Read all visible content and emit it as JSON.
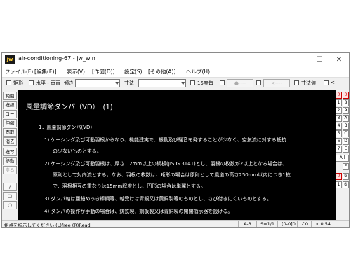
{
  "window": {
    "title": "air-conditioning-67 - jw_win",
    "icon_text": "jw",
    "controls": {
      "minimize": "─",
      "maximize": "☐",
      "close": "✕"
    }
  },
  "menu": [
    "ファイル(F)",
    "[編集(E)]",
    "表示(V)",
    "[作図(D)]",
    "設定(S)",
    "[その他(A)]",
    "ヘルプ(H)"
  ],
  "toolbar": {
    "rect_label": "矩形",
    "hv_label": "水平・垂直",
    "slope_label": "傾き",
    "dim_label": "寸法",
    "deg15_label": "15度毎",
    "btn_a": "●----",
    "btn_b": "<----",
    "dimval_label": "寸法値",
    "lt_label": "<"
  },
  "left_tools": [
    "範囲",
    "複線",
    "コーナー",
    "伸縮",
    "面取",
    "消去",
    "複写",
    "移動",
    "戻る",
    "/",
    "□",
    "○"
  ],
  "drawing": {
    "title": "風量調節ダンパ（VD）　(1)",
    "lines": [
      "1．風量調節ダンパ(VD)",
      "1) ケーシング及び可動羽根からなり、機能建実で、振動及び騒音を発することが少なく、空気流に対する抵抗",
      "の少ないものとする。",
      "2) ケーシング及び可動羽根は、厚さ1.2mm以上の鋼板(JIS G 3141)とし、羽根の枚数が2以上となる場合は、",
      "原則として対向流とする。なお、羽根の枚数は、矩形の場合は原則として風道の高さ250mm以内につき1枚",
      "で、羽根相互の重なりは15mm程度とし、円形の場合は単翼とする。",
      "3) ダンパ軸は亜鉛めっき棒鋼等、軸受けは青銅又は黄銅製等のものとし、さび付きにくいものとする。",
      "4) ダンパの操作が手動の場合は、鋳鉄製、鋼板製又は青銅製の開閉指示器を設ける。"
    ]
  },
  "right_tools": {
    "col1": [
      "0",
      "1",
      "2",
      "3",
      "4",
      "5",
      "6",
      "7",
      "All",
      "0",
      "1"
    ],
    "col2": [
      "0",
      "8",
      "9",
      "A",
      "B",
      "C",
      "D",
      "E",
      "F",
      "⑨",
      "⑧"
    ]
  },
  "status": {
    "message": "始点を指示してください (L)free (R)Read",
    "paper": "A-3",
    "scale": "S=1/1",
    "layer": "[0-0]0",
    "angle": "∠0",
    "zoom": "× 0.54"
  }
}
